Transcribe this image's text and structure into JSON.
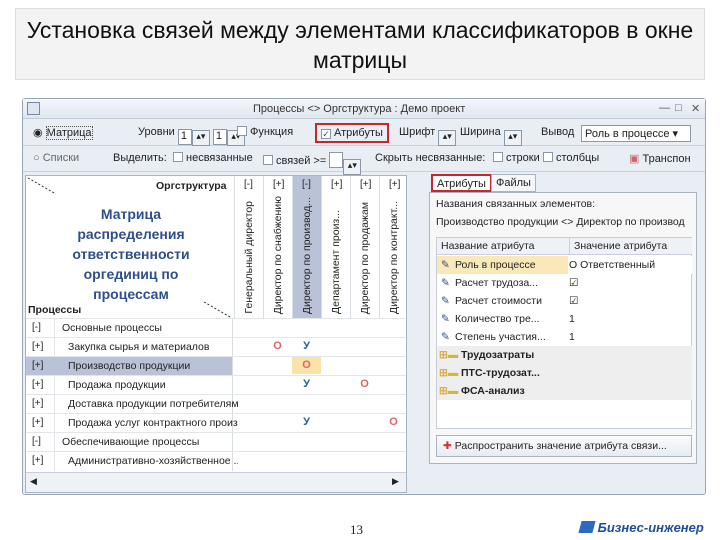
{
  "slide": {
    "title": "Установка связей между элементами классификаторов в окне матрицы",
    "page_number": "13",
    "logo": "Бизнес-инженер"
  },
  "window": {
    "title": "Процессы <> Оргструктура : Демо проект",
    "controls": [
      "—",
      "□",
      "✕"
    ]
  },
  "toolbar": {
    "mode_matrix": "Матрица",
    "mode_lists": "Списки",
    "levels_label": "Уровни",
    "level1": "1",
    "level2": "1",
    "function_label": "Функция",
    "attributes_label": "Атрибуты",
    "font_label": "Шрифт",
    "width_label": "Ширина",
    "output_label": "Вывод",
    "output_value": "Роль в процессе",
    "highlight_label": "Выделить:",
    "unlinked_label": "несвязанные",
    "links_label": "связей >=",
    "links_value": "",
    "hide_label": "Скрыть несвязанные:",
    "rows_label": "строки",
    "columns_label": "столбцы",
    "transpose_label": "Транспон"
  },
  "matrix": {
    "overlay_text": "Матрица распределения ответственности оргединиц по процессам",
    "org_header": "Оргструктура",
    "proc_header": "Процессы",
    "columns": [
      {
        "pm": "[-]",
        "label": "Генеральный директор"
      },
      {
        "pm": "[+]",
        "label": "Директор по снабжению"
      },
      {
        "pm": "[-]",
        "label": "Директор по производ..."
      },
      {
        "pm": "[+]",
        "label": "Департамент произ..."
      },
      {
        "pm": "[+]",
        "label": "Директор по продажам"
      },
      {
        "pm": "[+]",
        "label": "Директор по контракт..."
      }
    ],
    "rows": [
      {
        "pm": "[-]",
        "label": "Основные процессы",
        "cells": [
          "",
          "",
          "",
          "",
          "",
          ""
        ]
      },
      {
        "pm": "[+]",
        "label": "Закупка сырья и материалов",
        "cells": [
          "",
          "О",
          "У",
          "",
          "",
          ""
        ]
      },
      {
        "pm": "[+]",
        "label": "Производство продукции",
        "cells": [
          "",
          "",
          "О",
          "",
          "",
          ""
        ]
      },
      {
        "pm": "[+]",
        "label": "Продажа продукции",
        "cells": [
          "",
          "",
          "У",
          "",
          "О",
          ""
        ]
      },
      {
        "pm": "[+]",
        "label": "Доставка продукции потребителям",
        "cells": [
          "",
          "",
          "",
          "",
          "",
          ""
        ]
      },
      {
        "pm": "[+]",
        "label": "Продажа услуг контрактного произ",
        "cells": [
          "",
          "",
          "У",
          "",
          "",
          "О"
        ]
      },
      {
        "pm": "[-]",
        "label": "Обеспечивающие процессы",
        "cells": [
          "",
          "",
          "",
          "",
          "",
          ""
        ]
      },
      {
        "pm": "[+]",
        "label": "Административно-хозяйственное ...",
        "cells": [
          "",
          "",
          "",
          "",
          "",
          ""
        ]
      }
    ]
  },
  "right": {
    "tabs": [
      "Атрибуты",
      "Файлы"
    ],
    "linked_label": "Названия связанных элементов:",
    "linked_value": "Производство продукции <> Директор по производ",
    "col_name": "Название атрибута",
    "col_value": "Значение атрибута",
    "attrs": [
      {
        "name": "Роль в процессе",
        "value": "О  Ответственный"
      },
      {
        "name": "Расчет трудоза...",
        "value": "☑"
      },
      {
        "name": "Расчет стоимости",
        "value": "☑"
      },
      {
        "name": "Количество тре...",
        "value": "1"
      },
      {
        "name": "Степень участия...",
        "value": "1"
      }
    ],
    "groups": [
      "Трудозатраты",
      "ПТС-трудозат...",
      "ФСА-анализ"
    ],
    "spread_button": "Распространить значение атрибута связи..."
  }
}
